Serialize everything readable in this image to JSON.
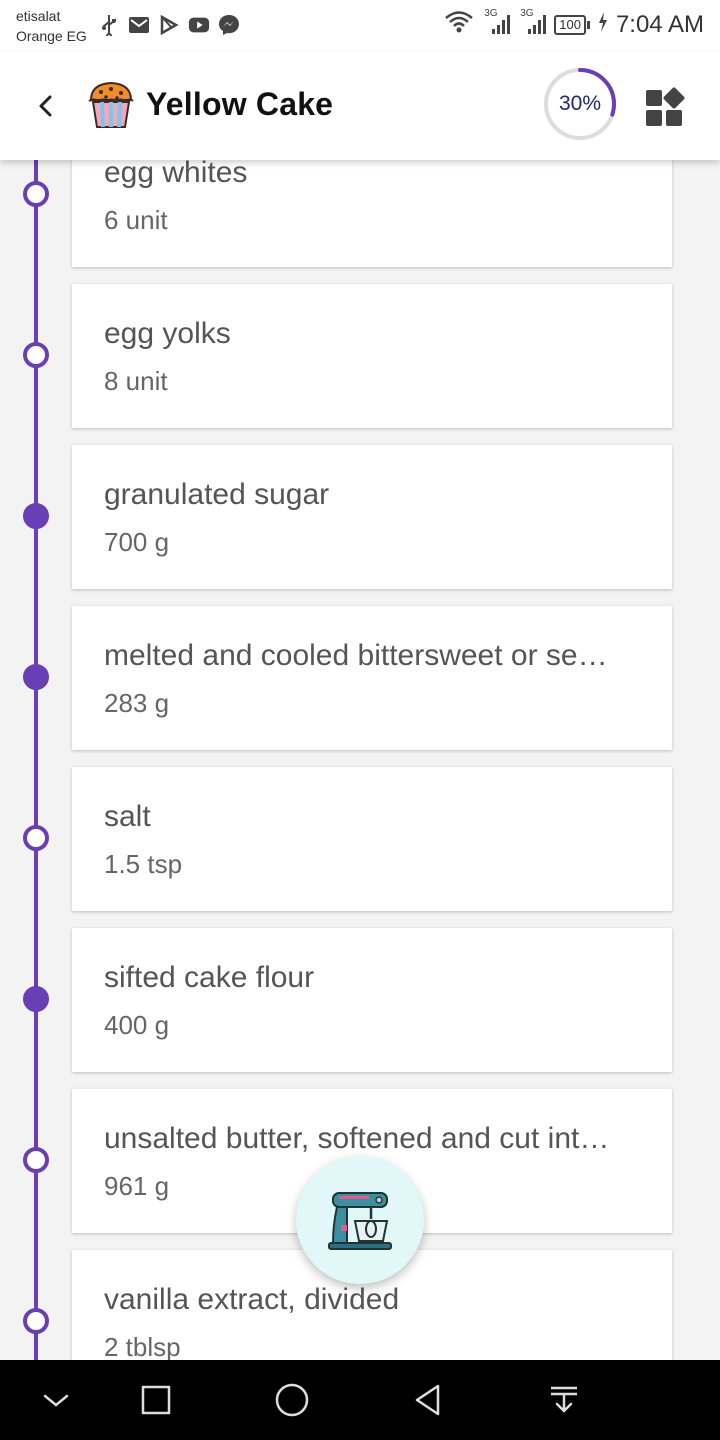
{
  "status_bar": {
    "carrier_line1": "etisalat",
    "carrier_line2": "Orange EG",
    "network_1": "3G",
    "network_2": "3G",
    "battery": "100",
    "time": "7:04 AM",
    "icons": [
      "usb-icon",
      "gmail-icon",
      "play-store-icon",
      "youtube-icon",
      "messenger-icon",
      "wifi-icon",
      "signal-icon",
      "signal-icon",
      "battery-icon",
      "charging-icon"
    ]
  },
  "app_bar": {
    "title": "Yellow Cake",
    "progress_label": "30%",
    "progress_value": 0.3,
    "icons": [
      "back-arrow-icon",
      "cupcake-icon",
      "dashboard-grid-icon"
    ]
  },
  "ingredients": [
    {
      "name": "egg whites",
      "quantity": "6 unit",
      "checked": false
    },
    {
      "name": "egg yolks",
      "quantity": "8 unit",
      "checked": false
    },
    {
      "name": "granulated sugar",
      "quantity": "700 g",
      "checked": true
    },
    {
      "name": "melted and cooled bittersweet or se…",
      "quantity": "283 g",
      "checked": true
    },
    {
      "name": "salt",
      "quantity": "1.5 tsp",
      "checked": false
    },
    {
      "name": "sifted cake flour",
      "quantity": "400 g",
      "checked": true
    },
    {
      "name": "unsalted butter, softened and cut int…",
      "quantity": "961 g",
      "checked": false
    },
    {
      "name": "vanilla extract, divided",
      "quantity": "2 tblsp",
      "checked": false
    }
  ],
  "fab": {
    "icon": "stand-mixer-icon"
  },
  "nav_bar": {
    "icons": [
      "collapse-chevron-icon",
      "recents-square-icon",
      "home-circle-icon",
      "back-triangle-icon",
      "notification-pull-icon"
    ]
  },
  "colors": {
    "accent": "#6a3fb5",
    "progress_text": "#1f2a6b",
    "fab_background": "#e2f7f8",
    "card_background": "#ffffff",
    "page_background": "#f3f3f3"
  }
}
